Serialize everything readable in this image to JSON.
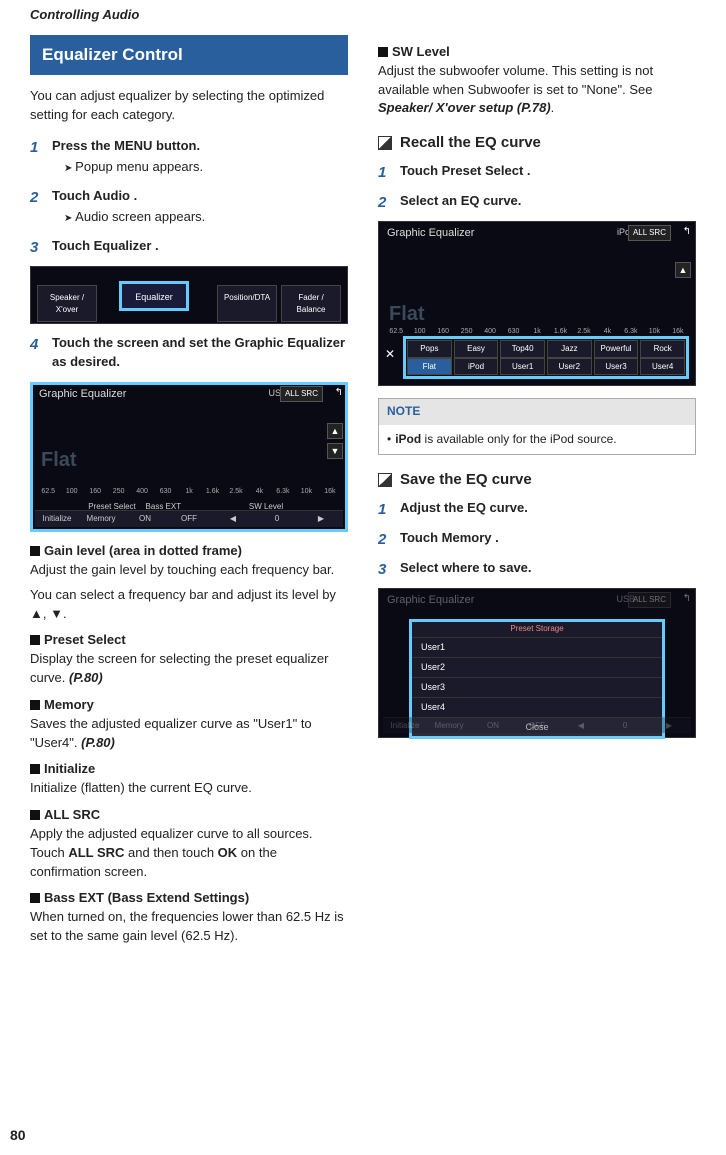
{
  "header": "Controlling Audio",
  "page_number": "80",
  "equalizer_control": {
    "title": "Equalizer Control",
    "intro": "You can adjust equalizer by selecting the optimized setting for each category.",
    "steps": [
      {
        "num": "1",
        "text_pre": "Press the ",
        "bold": "MENU",
        "text_post": " button.",
        "result": "Popup menu appears."
      },
      {
        "num": "2",
        "text_pre": "Touch ",
        "bold": "Audio",
        "text_post": " .",
        "result": "Audio screen appears."
      },
      {
        "num": "3",
        "text_pre": "Touch ",
        "bold": "Equalizer",
        "text_post": " ."
      },
      {
        "num": "4",
        "text": "Touch the screen and set the Graphic Equalizer as desired."
      }
    ],
    "screenshot1": {
      "buttons": [
        "Speaker / X'over",
        "Equalizer",
        "Position/DTA",
        "Fader / Balance"
      ]
    },
    "screenshot2": {
      "title": "Graphic Equalizer",
      "source": "USB",
      "allsrc": "ALL SRC",
      "flat": "Flat",
      "freqs": [
        "62.5",
        "100",
        "160",
        "250",
        "400",
        "630",
        "1k",
        "1.6k",
        "2.5k",
        "4k",
        "6.3k",
        "10k",
        "16k"
      ],
      "row_upper": [
        "",
        "Preset Select",
        "Bass EXT",
        "",
        "SW Level",
        ""
      ],
      "row_lower": [
        "Initialize",
        "Memory",
        "ON",
        "OFF",
        "◀",
        "0",
        "▶"
      ]
    },
    "items": [
      {
        "label": "Gain level (area in dotted frame)",
        "desc": "Adjust the gain level by touching each frequency bar.",
        "desc2": "You can select a frequency bar and adjust its level by ▲, ▼."
      },
      {
        "label": "Preset Select",
        "desc_pre": "Display the screen for selecting the preset equalizer curve. ",
        "ref": "(P.80)"
      },
      {
        "label": "Memory",
        "desc_pre": "Saves the adjusted equalizer curve as \"User1\" to \"User4\". ",
        "ref": "(P.80)"
      },
      {
        "label": "Initialize",
        "desc": "Initialize (flatten) the current EQ curve."
      },
      {
        "label": "ALL SRC",
        "desc_pre": "Apply the adjusted equalizer curve to all sources. Touch ",
        "bold1": "ALL SRC",
        "mid": " and then touch ",
        "bold2": "OK",
        "post": " on the confirmation screen."
      },
      {
        "label": "Bass EXT",
        "label_post": " (Bass Extend Settings)",
        "desc": "When turned on, the frequencies lower than 62.5 Hz is set to the same gain level (62.5 Hz)."
      }
    ]
  },
  "sw_level": {
    "label": "SW Level",
    "desc_pre": "Adjust the subwoofer volume. This setting is not available when Subwoofer is set to \"None\". See ",
    "ref": "Speaker/ X'over setup (P.78)",
    "post": "."
  },
  "recall": {
    "title": "Recall the EQ curve",
    "steps": [
      {
        "num": "1",
        "text_pre": "Touch ",
        "bold": "Preset Select",
        "text_post": " ."
      },
      {
        "num": "2",
        "text": "Select an EQ curve."
      }
    ],
    "screenshot": {
      "title": "Graphic Equalizer",
      "source": "iPod",
      "allsrc": "ALL SRC",
      "flat": "Flat",
      "freqs": [
        "62.5",
        "100",
        "160",
        "250",
        "400",
        "630",
        "1k",
        "1.6k",
        "2.5k",
        "4k",
        "6.3k",
        "10k",
        "16k"
      ],
      "close_x": "✕",
      "presets_row1": [
        "Pops",
        "Easy",
        "Top40",
        "Jazz",
        "Powerful",
        "Rock"
      ],
      "presets_row2": [
        "Flat",
        "iPod",
        "User1",
        "User2",
        "User3",
        "User4"
      ]
    },
    "note_label": "NOTE",
    "note_bold": "iPod",
    "note_text": " is available only for the iPod source."
  },
  "save": {
    "title": "Save the EQ curve",
    "steps": [
      {
        "num": "1",
        "text": "Adjust the EQ curve."
      },
      {
        "num": "2",
        "text_pre": "Touch ",
        "bold": "Memory",
        "text_post": " ."
      },
      {
        "num": "3",
        "text": "Select where to save."
      }
    ],
    "screenshot": {
      "title": "Graphic Equalizer",
      "source": "USB",
      "allsrc": "ALL SRC",
      "popup_title": "Preset Storage",
      "users": [
        "User1",
        "User2",
        "User3",
        "User4"
      ],
      "close": "Close",
      "row_lower": [
        "Initialize",
        "Memory",
        "ON",
        "OFF",
        "◀",
        "0",
        "▶"
      ]
    }
  }
}
